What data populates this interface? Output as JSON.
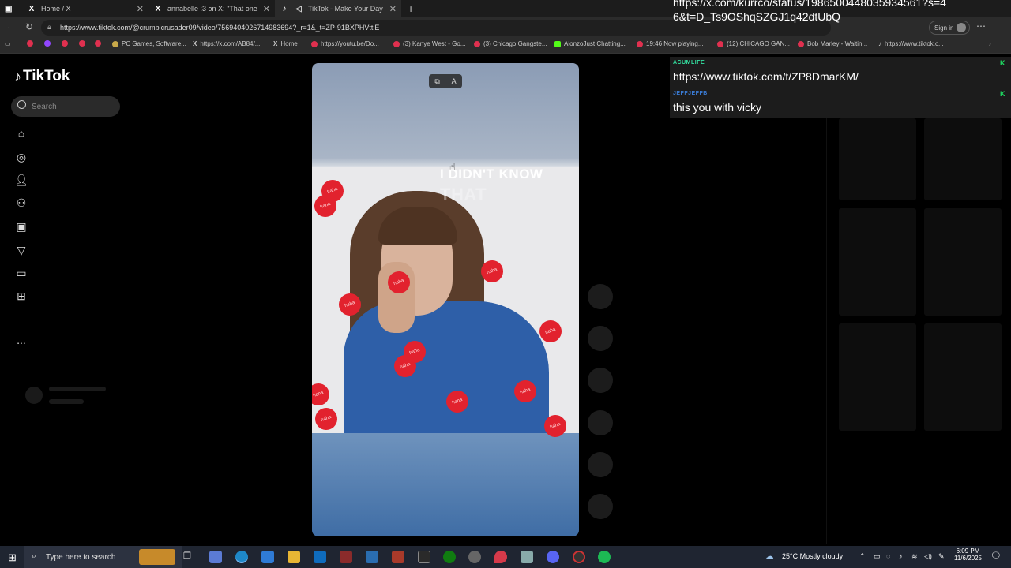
{
  "browser": {
    "tabs": [
      {
        "label": "Home / X",
        "icon": "x-icon",
        "active": false
      },
      {
        "label": "annabelle :3 on X: \"That one time",
        "icon": "x-icon",
        "active": false
      },
      {
        "label": "TikTok - Make Your Day",
        "icon": "tiktok-icon",
        "active": true
      }
    ],
    "url": "https://www.tiktok.com/@crumblcrusader09/video/7569404026714983694?_r=1&_t=ZP-91BXPHVttlE",
    "sign_in": "Sign in",
    "bookmarks": [
      "PC Games, Software...",
      "https://x.com/AB84/...",
      "Home",
      "https://youtu.be/Do...",
      "(3) Kanye West - Go...",
      "(3) Chicago Gangste...",
      "AlonzoJust Chatting...",
      "19:46 Now playing...",
      "(12) CHICAGO GAN...",
      "Bob Marley - Waitin...",
      "https://www.tiktok.c..."
    ]
  },
  "tiktok": {
    "logo": "TikTok",
    "search_placeholder": "Search",
    "nav_icons": [
      "home-icon",
      "explore-icon",
      "following-icon",
      "friends-icon",
      "live-icon",
      "messages-icon",
      "activity-icon",
      "upload-icon",
      "more-icon"
    ],
    "more": "...",
    "video_overlay_line1": "I DIDN'T KNOW",
    "video_overlay_line2": "THAT",
    "haha_sticker": "haha"
  },
  "chat": {
    "top_link": "https://x.com/kurrco/status/1986500448035934561?s=46&t=D_Ts9OShqSZGJ1q42dtUbQ",
    "messages": [
      {
        "user": "ACUMLIFE",
        "text": "https://www.tiktok.com/t/ZP8DmarKM/",
        "user_color": "#33e0a0"
      },
      {
        "user": "JEFFJEFFB",
        "text": "this you with vicky",
        "user_color": "#3a7bd5"
      }
    ]
  },
  "taskbar": {
    "search_placeholder": "Type here to search",
    "weather": "25°C  Mostly cloudy",
    "time": "6:09 PM",
    "date": "11/6/2025"
  }
}
